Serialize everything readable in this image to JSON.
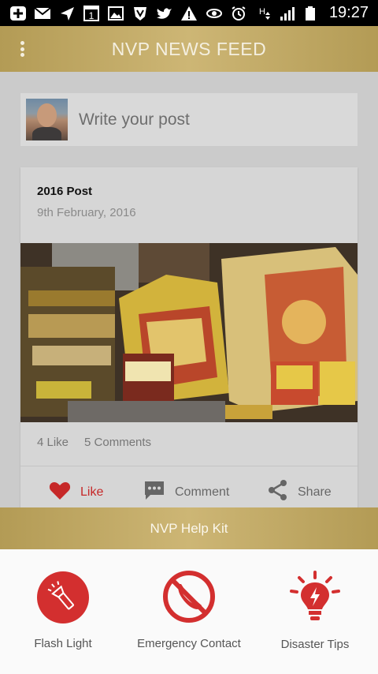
{
  "status_bar": {
    "time": "19:27",
    "icons": [
      "plus-icon",
      "mail-icon",
      "send-icon",
      "calendar-icon",
      "image-icon",
      "saavn-icon",
      "twitter-icon",
      "warning-icon",
      "eye-icon",
      "alarm-icon",
      "network-h-icon",
      "signal-icon",
      "battery-icon"
    ],
    "calendar_day": "1"
  },
  "app_bar": {
    "title": "NVP NEWS FEED"
  },
  "composer": {
    "placeholder": "Write your post"
  },
  "post": {
    "title": "2016 Post",
    "date": "9th February, 2016",
    "likes": "4 Like",
    "comments": "5 Comments",
    "actions": {
      "like": "Like",
      "comment": "Comment",
      "share": "Share"
    }
  },
  "help_kit": {
    "title": "NVP Help Kit",
    "tools": [
      {
        "label": "Flash Light"
      },
      {
        "label": "Emergency Contact"
      },
      {
        "label": "Disaster Tips"
      }
    ]
  },
  "colors": {
    "gold": "#c2ab68",
    "red": "#d32f2f",
    "like_red": "#c62828"
  }
}
